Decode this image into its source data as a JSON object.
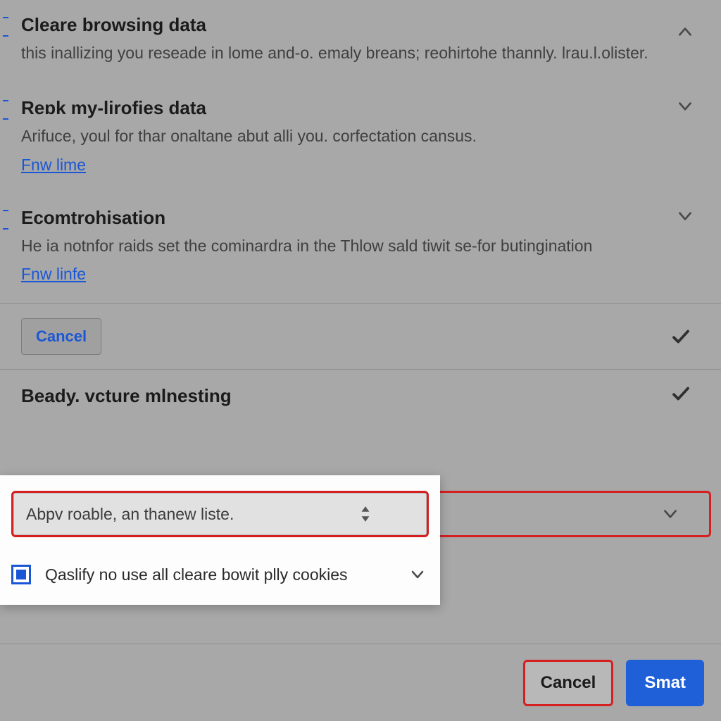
{
  "sections": [
    {
      "title": "Cleare browsing data",
      "desc": "this inallizing you reseade in lome and-o. emaly breans; reohirtohe thannly. lrau.l.olister.",
      "chevron": "up"
    },
    {
      "title": "Reɒk my-lirofies data",
      "desc": "Arifuce, youl for thar onaltane abut alli you. corfectation cansus.",
      "link": "Fnw lime",
      "chevron": "down"
    },
    {
      "title": "Ecomtrohisation",
      "desc": "He ia notnfor raids set the cominardra in the Thlow sald tiwit se-for butingination",
      "link": "Fnw linfe",
      "chevron": "down"
    }
  ],
  "cancel_row": {
    "label": "Cancel"
  },
  "row4": {
    "title": "Beady. vcture mlnesting"
  },
  "popup": {
    "dropdown_text": "Abpv roable, an thanew liste.",
    "checkbox_label": "Qaslify no use all cleare bowit plly cookies"
  },
  "footer": {
    "cancel": "Cancel",
    "submit": "Smat"
  }
}
